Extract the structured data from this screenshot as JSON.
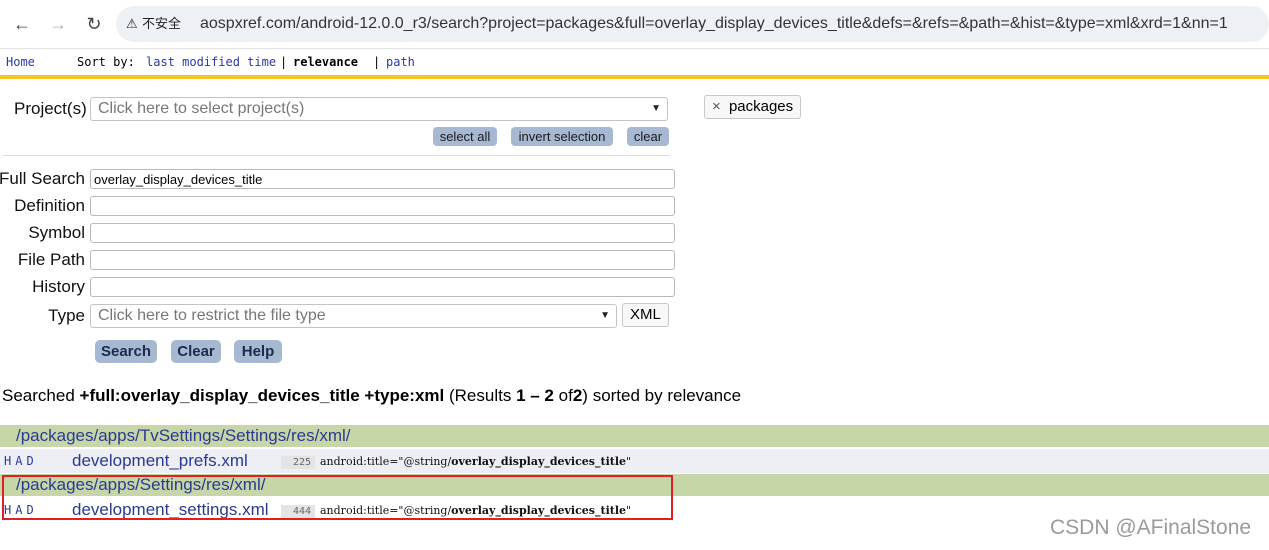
{
  "browser": {
    "security_label": "不安全",
    "url": "aospxref.com/android-12.0.0_r3/search?project=packages&full=overlay_display_devices_title&defs=&refs=&path=&hist=&type=xml&xrd=1&nn=1"
  },
  "nav": {
    "home": "Home",
    "sort_by": "Sort by:",
    "sort_options": [
      "last modified time",
      "relevance",
      "path"
    ],
    "separator": "|"
  },
  "form": {
    "project_label": "Project(s)",
    "project_placeholder": "Click here to select project(s)",
    "select_all": "select all",
    "invert_selection": "invert selection",
    "clear_small": "clear",
    "selected_project": "packages",
    "chip_remove": "×",
    "full_search_label": "Full Search",
    "full_search_value": "overlay_display_devices_title",
    "definition_label": "Definition",
    "symbol_label": "Symbol",
    "file_path_label": "File Path",
    "history_label": "History",
    "type_label": "Type",
    "type_placeholder": "Click here to restrict the file type",
    "type_value": "XML",
    "search_button": "Search",
    "clear_button": "Clear",
    "help_button": "Help"
  },
  "summary": {
    "prefix": "Searched",
    "query": "+full:overlay_display_devices_title +type:xml",
    "results_open": "(Results",
    "range": "1 – 2",
    "of": "of",
    "total": "2",
    "results_close": ")",
    "sorted": "sorted by relevance"
  },
  "results": [
    {
      "dir": "/packages/apps/TvSettings/Settings/res/xml/",
      "had": "HAD",
      "file": "development_prefs.xml",
      "line": "225",
      "code_pre": "android:title=\"@string/",
      "code_match": "overlay_display_devices_title",
      "code_post": "\""
    },
    {
      "dir": "/packages/apps/Settings/res/xml/",
      "had": "HAD",
      "file": "development_settings.xml",
      "line": "444",
      "code_pre": "android:title=\"@string/",
      "code_match": "overlay_display_devices_title",
      "code_post": "\""
    }
  ],
  "watermark": "CSDN @AFinalStone",
  "colors": {
    "accent_yellow": "#f4c524",
    "dir_row": "#c7d6a8",
    "button": "#a6b8d2",
    "highlight": "#e02020"
  }
}
